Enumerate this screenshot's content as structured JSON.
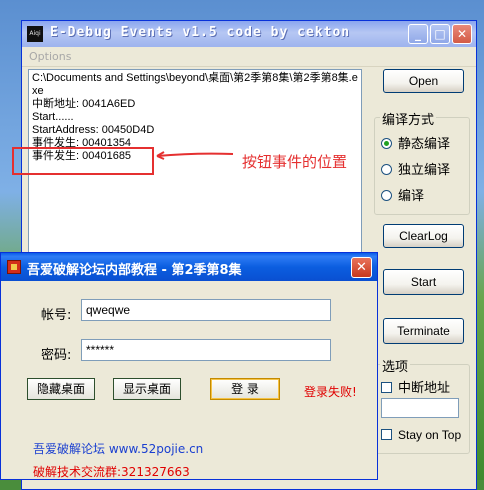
{
  "main_window": {
    "title": "E-Debug Events v1.5 code by cekton",
    "app_icon_label": "Aiqi",
    "menu": {
      "options": "Options"
    },
    "log_lines": [
      "C:\\Documents and Settings\\beyond\\桌面\\第2季第8集\\第2季第8集.exe",
      "中断地址: 0041A6ED",
      "Start......",
      "StartAddress: 00450D4D",
      "事件发生: 00401354",
      "事件发生: 00401685"
    ],
    "annotation": "按钮事件的位置",
    "buttons": {
      "open": "Open",
      "clearlog": "ClearLog",
      "start": "Start",
      "terminate": "Terminate"
    },
    "compile_group": {
      "title": "编译方式",
      "options": [
        "静态编译",
        "独立编译",
        "编译"
      ],
      "selected": 0
    },
    "options_group": {
      "title": "选项",
      "interrupt_address": "中断地址",
      "interrupt_value": "",
      "stay_on_top": "Stay on Top"
    }
  },
  "login_window": {
    "title": "吾爱破解论坛内部教程 - 第2季第8集",
    "account_label": "帐号:",
    "account_value": "qweqwe",
    "password_label": "密码:",
    "password_value": "******",
    "buttons": {
      "hide_desktop": "隐藏桌面",
      "show_desktop": "显示桌面",
      "login": "登 录"
    },
    "login_status": "登录失败!",
    "footer_site": "吾爱破解论坛 www.52pojie.cn",
    "footer_group": "破解技术交流群:321327663"
  },
  "colors": {
    "annotation": "#e53030",
    "xp_blue": "#0a5ce8",
    "fail": "#e00000"
  }
}
